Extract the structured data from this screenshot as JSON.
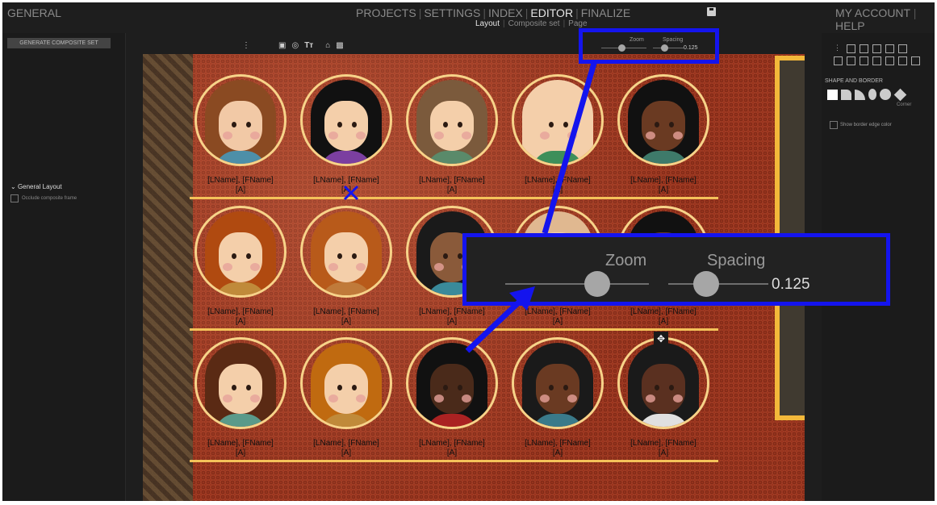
{
  "topbar": {
    "general": "GENERAL",
    "tabs": [
      {
        "label": "PROJECTS",
        "active": false
      },
      {
        "label": "SETTINGS",
        "active": false
      },
      {
        "label": "INDEX",
        "active": false
      },
      {
        "label": "EDITOR",
        "active": true
      },
      {
        "label": "FINALIZE",
        "active": false
      }
    ],
    "subtabs": [
      {
        "label": "Layout",
        "active": true
      },
      {
        "label": "Composite set",
        "active": false
      },
      {
        "label": "Page",
        "active": false
      }
    ],
    "account": "MY ACCOUNT",
    "help": "HELP"
  },
  "left_panel": {
    "generate_button": "GENERATE COMPOSITE SET",
    "section_title": "General Layout",
    "occlude_label": "Occlude composite frame"
  },
  "toolbar": {
    "zoom_label": "Zoom",
    "spacing_label": "Spacing",
    "spacing_value": "0.125",
    "zoom_level": 0.1,
    "spacing_level": 0.25,
    "icons": [
      "more-vertical-icon",
      "image-icon",
      "circle-target-icon",
      "text-tt-icon",
      "frame-icon",
      "grid-icon"
    ]
  },
  "right_panel": {
    "shape_border_title": "SHAPE AND BORDER",
    "corner_label": "Corner",
    "show_border_label": "Show border edge color"
  },
  "portraits": [
    {
      "name": "[LName], [FName]",
      "sub": "[A]"
    },
    {
      "name": "[LName], [FName]",
      "sub": "[A]"
    },
    {
      "name": "[LName], [FName]",
      "sub": "[A]"
    },
    {
      "name": "[LName], [FName]",
      "sub": "[A]"
    },
    {
      "name": "[LName], [FName]",
      "sub": "[A]"
    },
    {
      "name": "[LName], [FName]",
      "sub": "[A]"
    },
    {
      "name": "[LName], [FName]",
      "sub": "[A]"
    },
    {
      "name": "[LName], [FName]",
      "sub": "[A]"
    },
    {
      "name": "[LName], [FName]",
      "sub": "[A]"
    },
    {
      "name": "[LName], [FName]",
      "sub": "[A]"
    },
    {
      "name": "[LName], [FName]",
      "sub": "[A]"
    },
    {
      "name": "[LName], [FName]",
      "sub": "[A]"
    },
    {
      "name": "[LName], [FName]",
      "sub": "[A]"
    },
    {
      "name": "[LName], [FName]",
      "sub": "[A]"
    },
    {
      "name": "[LName], [FName]",
      "sub": "[A]"
    }
  ],
  "colors": {
    "annotation_blue": "#1414ee",
    "row_divider": "#f4c25a",
    "portrait_border": "#f7d389"
  }
}
